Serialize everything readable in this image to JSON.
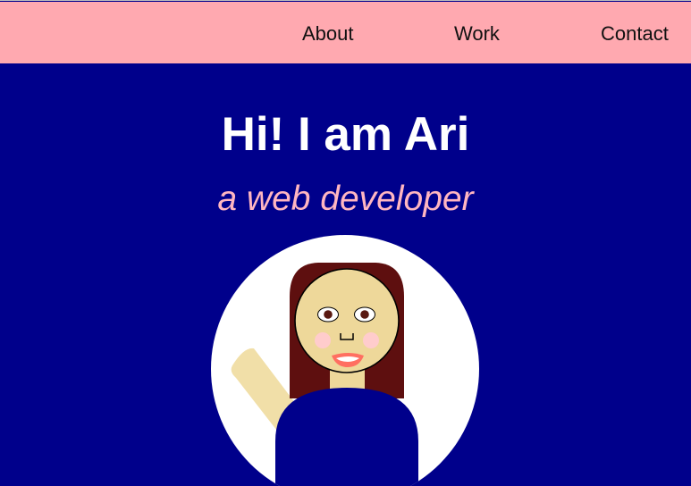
{
  "nav": {
    "items": [
      {
        "label": "About"
      },
      {
        "label": "Work"
      },
      {
        "label": "Contact"
      }
    ]
  },
  "hero": {
    "title": "Hi! I am Ari",
    "subtitle": "a web developer"
  },
  "colors": {
    "nav_background": "#ffa9b0",
    "page_background": "#00008b",
    "title": "#ffffff",
    "subtitle": "#ffb6c1",
    "avatar_circle": "#ffffff",
    "hair": "#5e0f0f",
    "skin": "#eed89a",
    "shirt": "#00008b",
    "cheeks": "#ffcccc",
    "lips": "#ff6f61"
  },
  "avatar": {
    "description_icon": "avatar-illustration-icon"
  }
}
